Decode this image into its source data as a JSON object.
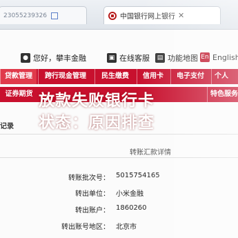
{
  "browser": {
    "left_tab_text": "23055239326",
    "active_tab_title": "中国银行网上银行"
  },
  "utility": {
    "greeting": "您好，攀丰金融",
    "service": "在线客服",
    "map": "功能地图",
    "english": "English"
  },
  "nav1": [
    "贷款管理",
    "跨行现金管理",
    "民生缴费",
    "信用卡",
    "电子支付",
    "个人"
  ],
  "nav2": [
    "证券期货",
    "特色服务"
  ],
  "overlay": {
    "line1": "放款失败银行卡",
    "line2": "状态：原因排查"
  },
  "content": {
    "record_label": "记录",
    "subtitle": "转账汇款详情",
    "rows": [
      {
        "key": "转账批次号：",
        "value": "5015754165"
      },
      {
        "key": "转出单位：",
        "value": "小米金融"
      },
      {
        "key": "转出账户：",
        "value": "1860260"
      },
      {
        "key": "转出账号地区：",
        "value": "北京市"
      }
    ]
  },
  "colors": {
    "brand_red": "#c8102e"
  }
}
